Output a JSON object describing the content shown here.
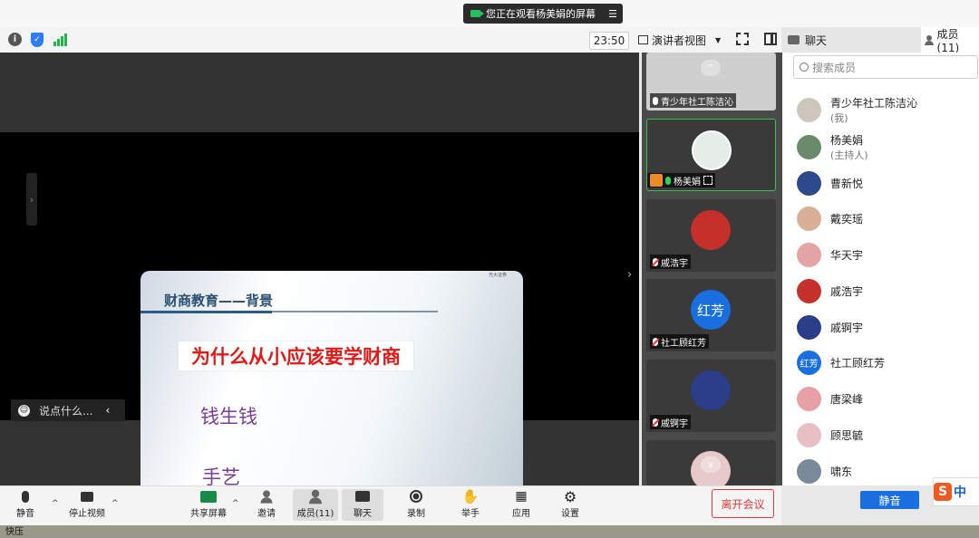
{
  "banner": {
    "sharing_text": "您正在观看杨美娟的屏幕"
  },
  "topbar": {
    "time": "23:50",
    "view_mode": "演讲者视图"
  },
  "panel_tabs": {
    "chat": "聊天",
    "members": "成员(11)"
  },
  "slide": {
    "title": "财商教育——背景",
    "question": "为什么从小应该要学财商",
    "point1": "钱生钱",
    "point2": "手艺",
    "logo": "光大证券"
  },
  "chat_box": {
    "placeholder": "说点什么..."
  },
  "tiles": [
    {
      "name": "青少年社工陈洁沁",
      "avatar_text": "",
      "color": "#8e8e8e"
    },
    {
      "name": "杨美娟",
      "avatar_text": "",
      "color": "#e6ede8"
    },
    {
      "name": "戚浩宇",
      "avatar_text": "",
      "color": "#c5302a"
    },
    {
      "name": "社工顾红芳",
      "avatar_text": "红芳",
      "color": "#1a6fe0"
    },
    {
      "name": "戚锕宇",
      "avatar_text": "",
      "color": "#2c3e8a"
    },
    {
      "name": "",
      "avatar_text": "",
      "color": "#e7c9c9"
    }
  ],
  "members_panel": {
    "search_placeholder": "搜索成员",
    "members": [
      {
        "name": "青少年社工陈洁沁",
        "role": "(我)",
        "avatar_text": "",
        "color": "#ccc6bc"
      },
      {
        "name": "杨美娟",
        "role": "(主持人)",
        "avatar_text": "",
        "color": "#6a8a6a"
      },
      {
        "name": "曹新悦",
        "role": "",
        "avatar_text": "",
        "color": "#2d4a8a"
      },
      {
        "name": "戴奕瑶",
        "role": "",
        "avatar_text": "",
        "color": "#d8b096"
      },
      {
        "name": "华天宇",
        "role": "",
        "avatar_text": "",
        "color": "#e3a4a4"
      },
      {
        "name": "戚浩宇",
        "role": "",
        "avatar_text": "",
        "color": "#c5302a"
      },
      {
        "name": "戚锕宇",
        "role": "",
        "avatar_text": "",
        "color": "#2c3e8a"
      },
      {
        "name": "社工顾红芳",
        "role": "",
        "avatar_text": "红芳",
        "color": "#1a6fe0"
      },
      {
        "name": "唐梁峰",
        "role": "",
        "avatar_text": "",
        "color": "#e6a0a6"
      },
      {
        "name": "顾思毓",
        "role": "",
        "avatar_text": "",
        "color": "#e7bfc4"
      },
      {
        "name": "啸东",
        "role": "",
        "avatar_text": "",
        "color": "#7a8a9a"
      }
    ],
    "mute_all": "静音"
  },
  "toolbar": {
    "mute": "静音",
    "stop_video": "停止视频",
    "share_screen": "共享屏幕",
    "invite": "邀请",
    "members": "成员(11)",
    "chat": "聊天",
    "record": "录制",
    "raise_hand": "举手",
    "apps": "应用",
    "settings": "设置",
    "leave": "离开会议"
  },
  "taskbar": {
    "hotkey": "快压"
  },
  "ime": {
    "lang": "中"
  }
}
